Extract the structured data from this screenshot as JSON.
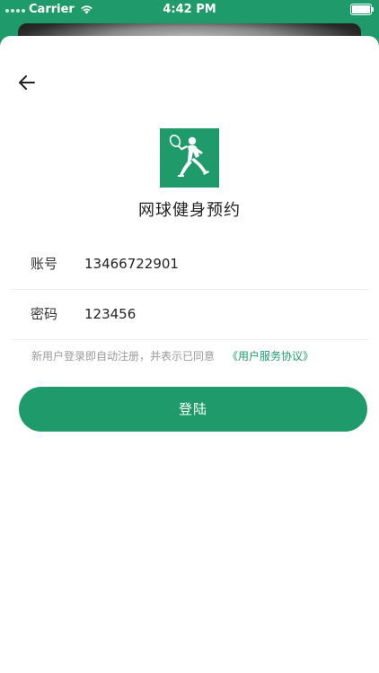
{
  "status_bar": {
    "carrier": "Carrier",
    "time": "4:42 PM"
  },
  "header": {
    "back_icon": "arrow-left-icon"
  },
  "app": {
    "logo_icon": "tennis-player-icon",
    "title": "网球健身预约"
  },
  "form": {
    "account_label": "账号",
    "account_value": "13466722901",
    "password_label": "密码",
    "password_value": "123456"
  },
  "agreement": {
    "text": "新用户登录即自动注册，并表示已同意",
    "link": "《用户服务协议》"
  },
  "login_button": {
    "label": "登陆"
  },
  "colors": {
    "brand": "#1f9a6a",
    "background": "#ffffff",
    "muted_text": "#9a9a9a"
  }
}
